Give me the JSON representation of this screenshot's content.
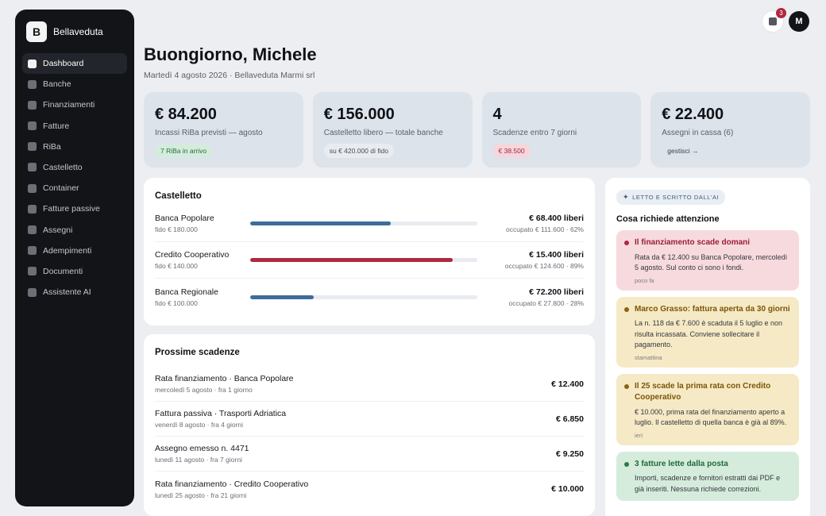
{
  "brand": {
    "logo_letter": "B",
    "name": "Bellaveduta"
  },
  "sidebar": {
    "items": [
      {
        "label": "Dashboard",
        "active": true
      },
      {
        "label": "Banche"
      },
      {
        "label": "Finanziamenti"
      },
      {
        "label": "Fatture"
      },
      {
        "label": "RiBa"
      },
      {
        "label": "Castelletto"
      },
      {
        "label": "Container"
      },
      {
        "label": "Fatture passive"
      },
      {
        "label": "Assegni"
      },
      {
        "label": "Adempimenti"
      },
      {
        "label": "Documenti"
      },
      {
        "label": "Assistente AI"
      }
    ]
  },
  "topbar": {
    "notification_count": "3",
    "avatar_initial": "M"
  },
  "header": {
    "title": "Buongiorno, Michele",
    "subtitle": "Martedì 4 agosto 2026 · Bellaveduta Marmi srl"
  },
  "kpis": [
    {
      "value": "€ 84.200",
      "label": "Incassi RiBa previsti — agosto",
      "tag": "7 RiBa in arrivo",
      "tag_style": "green"
    },
    {
      "value": "€ 156.000",
      "label": "Castelletto libero — totale banche",
      "tag": "su € 420.000 di fido",
      "tag_style": "grey"
    },
    {
      "value": "4",
      "label": "Scadenze entro 7 giorni",
      "tag": "€ 38.500",
      "tag_style": "red"
    },
    {
      "value": "€ 22.400",
      "label": "Assegni in cassa (6)",
      "tag": "gestisci →",
      "tag_style": "link"
    }
  ],
  "castelletto": {
    "title": "Castelletto",
    "banks": [
      {
        "name": "Banca Popolare",
        "fido": "fido € 180.000",
        "free": "€ 68.400 liberi",
        "occupied": "occupato € 111.600 · 62%",
        "usage": 0.62,
        "color": "#3d6d99"
      },
      {
        "name": "Credito Cooperativo",
        "fido": "fido € 140.000",
        "free": "€ 15.400 liberi",
        "occupied": "occupato € 124.600 · 89%",
        "usage": 0.89,
        "color": "#ad2a40"
      },
      {
        "name": "Banca Regionale",
        "fido": "fido € 100.000",
        "free": "€ 72.200 liberi",
        "occupied": "occupato € 27.800 · 28%",
        "usage": 0.28,
        "color": "#3d6d99"
      }
    ]
  },
  "scadenze": {
    "title": "Prossime scadenze",
    "items": [
      {
        "title": "Rata finanziamento · Banca Popolare",
        "sub": "mercoledì 5 agosto · fra 1 giorno",
        "amount": "€ 12.400"
      },
      {
        "title": "Fattura passiva · Trasporti Adriatica",
        "sub": "venerdì 8 agosto · fra 4 giorni",
        "amount": "€ 6.850"
      },
      {
        "title": "Assegno emesso n. 4471",
        "sub": "lunedì 11 agosto · fra 7 giorni",
        "amount": "€ 9.250"
      },
      {
        "title": "Rata finanziamento · Credito Cooperativo",
        "sub": "lunedì 25 agosto · fra 21 giorni",
        "amount": "€ 10.000"
      }
    ]
  },
  "ai": {
    "chip": "LETTO E SCRITTO DALL'AI",
    "chip_icon": "✦",
    "heading": "Cosa richiede attenzione",
    "cards": [
      {
        "style": "red",
        "title": "Il finanziamento scade domani",
        "body": "Rata da € 12.400 su Banca Popolare, mercoledì 5 agosto. Sul conto ci sono i fondi.",
        "time": "poco fa"
      },
      {
        "style": "yellow",
        "title": "Marco Grasso: fattura aperta da 30 giorni",
        "body": "La n. 118 da € 7.600 è scaduta il 5 luglio e non risulta incassata. Conviene sollecitare il pagamento.",
        "time": "stamattina"
      },
      {
        "style": "yellow",
        "title": "Il 25 scade la prima rata con Credito Cooperativo",
        "body": "€ 10.000, prima rata del finanziamento aperto a luglio. Il castelletto di quella banca è già al 89%.",
        "time": "ieri"
      },
      {
        "style": "green",
        "title": "3 fatture lette dalla posta",
        "body": "Importi, scadenze e fornitori estratti dai PDF e già inseriti. Nessuna richiede correzioni.",
        "time": ""
      }
    ]
  }
}
